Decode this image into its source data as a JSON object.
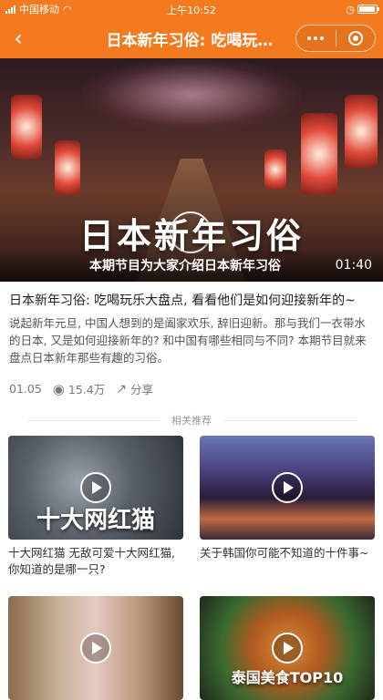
{
  "status_bar": {
    "carrier": "中国移动",
    "time": "上午10:52",
    "battery_percent": 95
  },
  "nav": {
    "title": "日本新年习俗: 吃喝玩…"
  },
  "hero": {
    "title_overlay": "日本新年习俗",
    "caption": "本期节目为大家介绍日本新年习俗",
    "duration": "01:40"
  },
  "article": {
    "title": "日本新年习俗: 吃喝玩乐大盘点, 看看他们是如何迎接新年的~",
    "description": "说起新年元旦, 中国人想到的是阖家欢乐, 辞旧迎新。那与我们一衣带水的日本, 又是如何迎接新年的? 和中国有哪些相同与不同? 本期节目就来盘点日本新年那些有趣的习俗。",
    "date": "01.05",
    "views": "15.4万",
    "share_label": "分享"
  },
  "related": {
    "heading": "相关推荐",
    "items": [
      {
        "title": "十大网红猫 无敌可爱十大网红猫, 你知道的是哪一只?",
        "overlay": "十大网红猫"
      },
      {
        "title": "关于韩国你可能不知道的十件事~",
        "overlay": ""
      },
      {
        "title": "",
        "overlay": ""
      },
      {
        "title": "",
        "overlay": "泰国美食TOP10"
      }
    ]
  },
  "colors": {
    "accent": "#f47a1f"
  },
  "icons": {
    "back": "chevron-left-icon",
    "more": "more-dots-icon",
    "close": "target-icon",
    "views": "eye-icon",
    "share": "share-icon"
  }
}
